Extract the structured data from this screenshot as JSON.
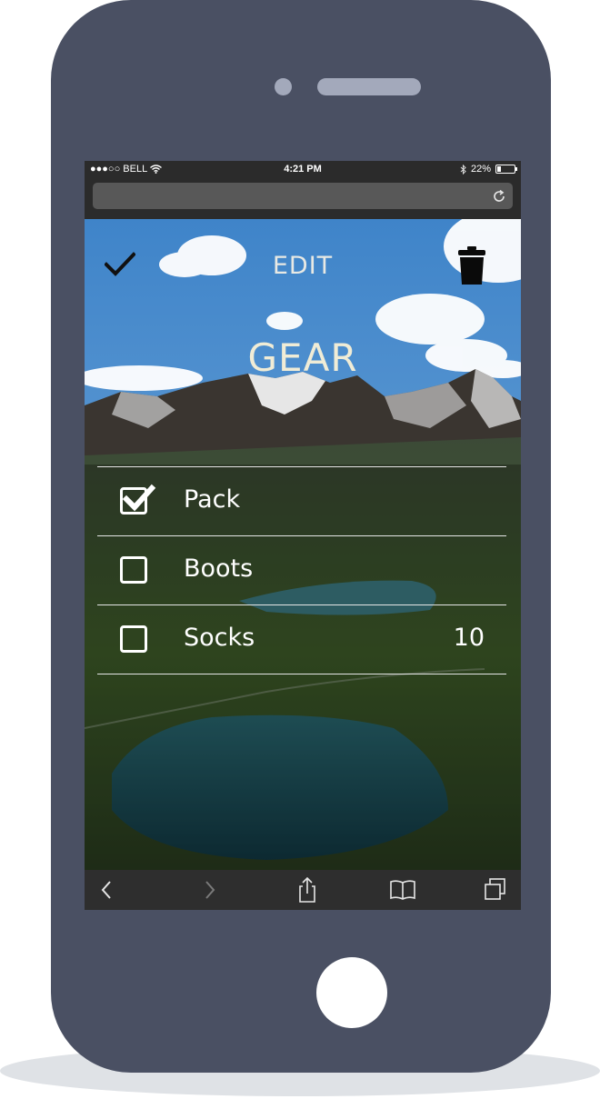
{
  "status_bar": {
    "carrier": "●●●○○ BELL",
    "time": "4:21 PM",
    "battery": "22%",
    "battery_level": 0.22
  },
  "browser": {
    "url": "",
    "icons": [
      "reload-icon",
      "back-icon",
      "forward-icon",
      "share-icon",
      "bookmarks-icon",
      "tabs-icon"
    ]
  },
  "app": {
    "header_title": "EDIT",
    "list_title": "GEAR",
    "icons": [
      "checkmark-icon",
      "trash-icon"
    ],
    "items": [
      {
        "label": "Pack",
        "checked": true,
        "quantity": ""
      },
      {
        "label": "Boots",
        "checked": false,
        "quantity": ""
      },
      {
        "label": "Socks",
        "checked": false,
        "quantity": "10"
      }
    ]
  },
  "colors": {
    "phone_body": "#4a5063",
    "title_text": "#f0ecd6"
  }
}
